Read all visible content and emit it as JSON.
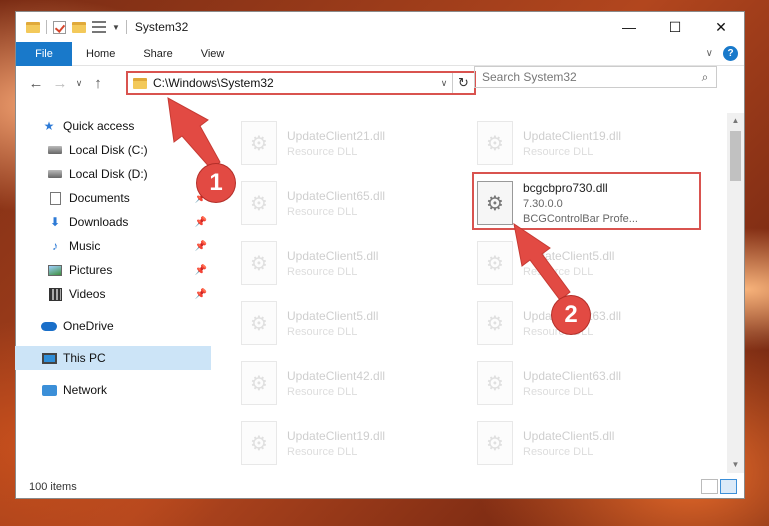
{
  "window": {
    "title": "System32",
    "controls": {
      "minimize": "—",
      "maximize": "☐",
      "close": "✕"
    }
  },
  "ribbon": {
    "tabs": [
      "File",
      "Home",
      "Share",
      "View"
    ],
    "expand_icon": "chevron-down-icon",
    "help_label": "?"
  },
  "navigation": {
    "back": "←",
    "forward": "→",
    "recent": "∨",
    "up": "↑",
    "address_path": "C:\\Windows\\System32",
    "refresh": "↻",
    "search_placeholder": "Search System32",
    "search_icon": "⌕"
  },
  "sidebar": {
    "items": [
      {
        "label": "Quick access",
        "icon": "star-icon"
      },
      {
        "label": "Local Disk (C:)",
        "icon": "disk-icon"
      },
      {
        "label": "Local Disk (D:)",
        "icon": "disk-icon"
      },
      {
        "label": "Documents",
        "icon": "documents-icon",
        "pinned": true
      },
      {
        "label": "Downloads",
        "icon": "downloads-icon",
        "pinned": true
      },
      {
        "label": "Music",
        "icon": "music-icon",
        "pinned": true
      },
      {
        "label": "Pictures",
        "icon": "pictures-icon",
        "pinned": true
      },
      {
        "label": "Videos",
        "icon": "videos-icon",
        "pinned": true
      },
      {
        "label": "OneDrive",
        "icon": "cloud-icon"
      },
      {
        "label": "This PC",
        "icon": "computer-icon",
        "selected": true
      },
      {
        "label": "Network",
        "icon": "network-icon"
      }
    ],
    "pin_glyph": "📌"
  },
  "files": [
    {
      "name": "UpdateClient21.dll",
      "type": "Resource DLL"
    },
    {
      "name": "UpdateClient19.dll",
      "type": "Resource DLL"
    },
    {
      "name": "UpdateClient65.dll",
      "type": "Resource DLL"
    },
    {
      "name": "bcgcbpro730.dll",
      "type": "7.30.0.0",
      "description": "BCGControlBar Profe...",
      "highlighted": true
    },
    {
      "name": "UpdateClient5.dll",
      "type": "Resource DLL"
    },
    {
      "name": "UpdateClient5.dll",
      "type": "Resource DLL"
    },
    {
      "name": "UpdateClient5.dll",
      "type": "Resource DLL"
    },
    {
      "name": "UpdateClient63.dll",
      "type": "Resource DLL"
    },
    {
      "name": "UpdateClient42.dll",
      "type": "Resource DLL"
    },
    {
      "name": "UpdateClient63.dll",
      "type": "Resource DLL"
    },
    {
      "name": "UpdateClient19.dll",
      "type": "Resource DLL"
    },
    {
      "name": "UpdateClient5.dll",
      "type": "Resource DLL"
    }
  ],
  "status": {
    "item_count": "100 items"
  },
  "annotations": {
    "badge_1": "1",
    "badge_2": "2",
    "color": "#e24a43"
  }
}
